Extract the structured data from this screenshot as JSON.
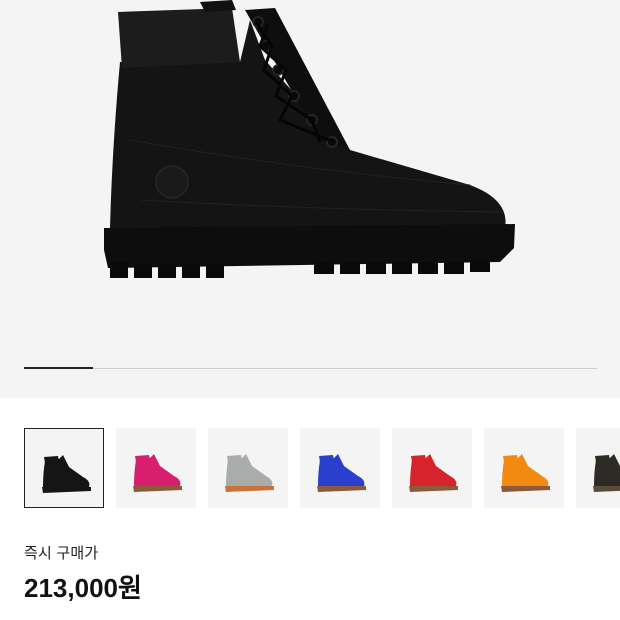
{
  "product": {
    "main_image_icon": "boot-icon",
    "main_color": "#141414"
  },
  "gallery": {
    "progress_fraction": 0.12,
    "thumbnails": [
      {
        "color": "#151515",
        "sole": "#151515",
        "selected": true
      },
      {
        "color": "#d81f6e",
        "sole": "#8a5a3a",
        "selected": false
      },
      {
        "color": "#a9acab",
        "sole": "#c8733a",
        "selected": false
      },
      {
        "color": "#2b3fcf",
        "sole": "#8a5a3a",
        "selected": false
      },
      {
        "color": "#d7232b",
        "sole": "#8a5a3a",
        "selected": false
      },
      {
        "color": "#f28a12",
        "sole": "#8a5a3a",
        "selected": false
      },
      {
        "color": "#2e2b26",
        "sole": "#5a4a3a",
        "selected": false
      }
    ]
  },
  "price": {
    "label": "즉시 구매가",
    "value": "213,000원"
  }
}
